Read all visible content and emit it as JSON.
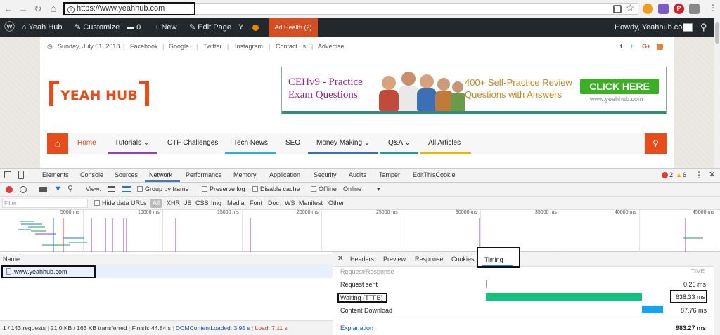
{
  "browser": {
    "url": "https://www.yeahhub.com",
    "nav": {
      "back": "←",
      "forward": "→",
      "reload": "↻",
      "home": "⌂"
    }
  },
  "wpbar": {
    "site_name": "Yeah Hub",
    "customize": "Customize",
    "comments_count": "0",
    "new_label": "New",
    "edit_page": "Edit Page",
    "ad_health": "Ad Health (2)",
    "howdy": "Howdy, Yeahhub.com"
  },
  "site": {
    "topbar": {
      "date": "Sunday, July 01, 2018",
      "links": [
        "Facebook",
        "Google+",
        "Twitter",
        "Instagram",
        "Contact us",
        "Advertise"
      ]
    },
    "logo_text": "YEAH HUB",
    "banner": {
      "title": "CEHv9 - Practice Exam Questions",
      "review_line1": "400+ Self-Practice Review",
      "review_line2": "Questions with Answers",
      "button": "CLICK HERE",
      "url": "www.yeahhub.com"
    },
    "menu": [
      {
        "label": "Home",
        "color": "#e74c1a"
      },
      {
        "label": "Tutorials ⌄",
        "color": "#8e44ad"
      },
      {
        "label": "CTF Challenges",
        "color": "#e74c1a"
      },
      {
        "label": "Tech News",
        "color": "#2bb3c9"
      },
      {
        "label": "SEO",
        "color": "#e74c1a"
      },
      {
        "label": "Money Making ⌄",
        "color": "#3a6fb0"
      },
      {
        "label": "Q&A ⌄",
        "color": "#1f9d8a"
      },
      {
        "label": "All Articles",
        "color": "#e6b800"
      }
    ]
  },
  "devtools": {
    "tabs": [
      "Elements",
      "Console",
      "Sources",
      "Network",
      "Performance",
      "Memory",
      "Application",
      "Security",
      "Audits",
      "Tamper",
      "EditThisCookie"
    ],
    "active_tab": "Network",
    "errors": "2",
    "warnings": "6",
    "toolbar": {
      "view": "View:",
      "group_by_frame": "Group by frame",
      "preserve_log": "Preserve log",
      "disable_cache": "Disable cache",
      "offline": "Offline",
      "online": "Online"
    },
    "filter": {
      "placeholder": "Filter",
      "hide_data_urls": "Hide data URLs",
      "types": [
        "All",
        "XHR",
        "JS",
        "CSS",
        "Img",
        "Media",
        "Font",
        "Doc",
        "WS",
        "Manifest",
        "Other"
      ]
    },
    "timeline_ticks": [
      "5000 ms",
      "10000 ms",
      "15000 ms",
      "20000 ms",
      "25000 ms",
      "30000 ms",
      "35000 ms",
      "40000 ms",
      "45000 ms"
    ],
    "name_header": "Name",
    "request": "www.yeahhub.com",
    "status": {
      "requests": "1 / 143 requests",
      "transferred": "21.0 KB / 163 KB transferred",
      "finish": "Finish: 44.84 s",
      "dcl": "DOMContentLoaded: 3.95 s",
      "load": "Load: 7.11 s"
    },
    "detail_tabs": [
      "Headers",
      "Preview",
      "Response",
      "Cookies",
      "Timing"
    ],
    "active_detail_tab": "Timing",
    "timing": {
      "section": "Request/Response",
      "time_header": "TIME",
      "rows": [
        {
          "label": "Request sent",
          "value": "0.26 ms"
        },
        {
          "label": "Waiting (TTFB)",
          "value": "638.33 ms"
        },
        {
          "label": "Content Download",
          "value": "87.76 ms"
        }
      ],
      "explanation": "Explanation",
      "total": "983.27 ms"
    }
  }
}
